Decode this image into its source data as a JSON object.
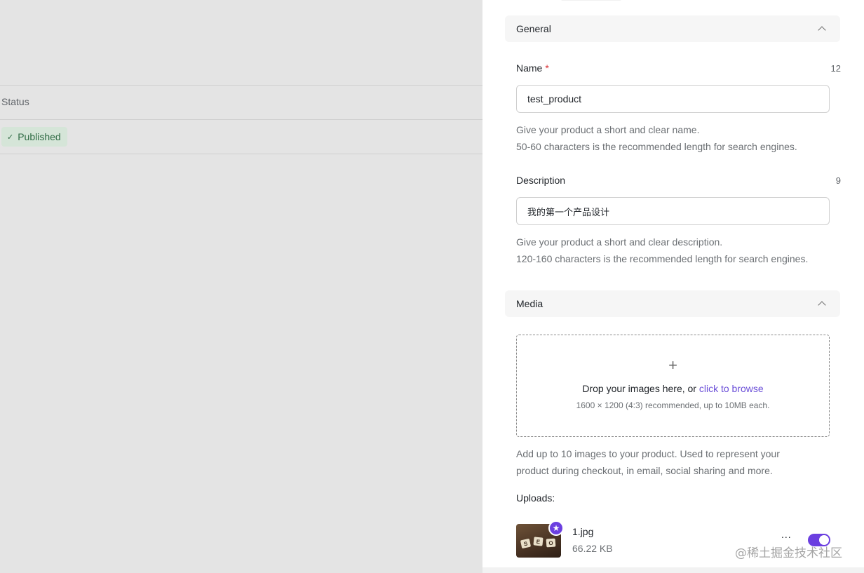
{
  "table": {
    "status_header": "Status",
    "rows": [
      {
        "status_badge": "Published"
      }
    ]
  },
  "general": {
    "section_title": "General",
    "name": {
      "label": "Name",
      "required_marker": "*",
      "counter": "12",
      "value": "test_product",
      "help_line1": "Give your product a short and clear name.",
      "help_line2": "50-60 characters is the recommended length for search engines."
    },
    "description": {
      "label": "Description",
      "counter": "9",
      "value": "我的第一个产品设计",
      "help_line1": "Give your product a short and clear description.",
      "help_line2": "120-160 characters is the recommended length for search engines."
    }
  },
  "media": {
    "section_title": "Media",
    "dropzone": {
      "plus_glyph": "+",
      "main_text": "Drop your images here, or ",
      "link_text": "click to browse",
      "sub_text": "1600 × 1200 (4:3) recommended, up to 10MB each."
    },
    "help_line1": "Add up to 10 images to your product. Used to represent your",
    "help_line2": "product during checkout, in email, social sharing and more.",
    "uploads_label": "Uploads:",
    "uploads": [
      {
        "file_name": "1.jpg",
        "file_size": "66.22 KB",
        "more_label": "...",
        "featured": true,
        "enabled": true
      }
    ]
  },
  "thumb_tiles": [
    "S",
    "E",
    "O"
  ],
  "watermark": "@稀土掘金技术社区",
  "colors": {
    "accent": "#6b3fe0",
    "link": "#6b4fd8",
    "required": "#d93035",
    "published_bg": "#d5e5d8",
    "published_text": "#2f6b44"
  },
  "icons": {
    "published": "check-icon",
    "section_toggle": "chevron-up-icon",
    "featured": "star-icon"
  }
}
